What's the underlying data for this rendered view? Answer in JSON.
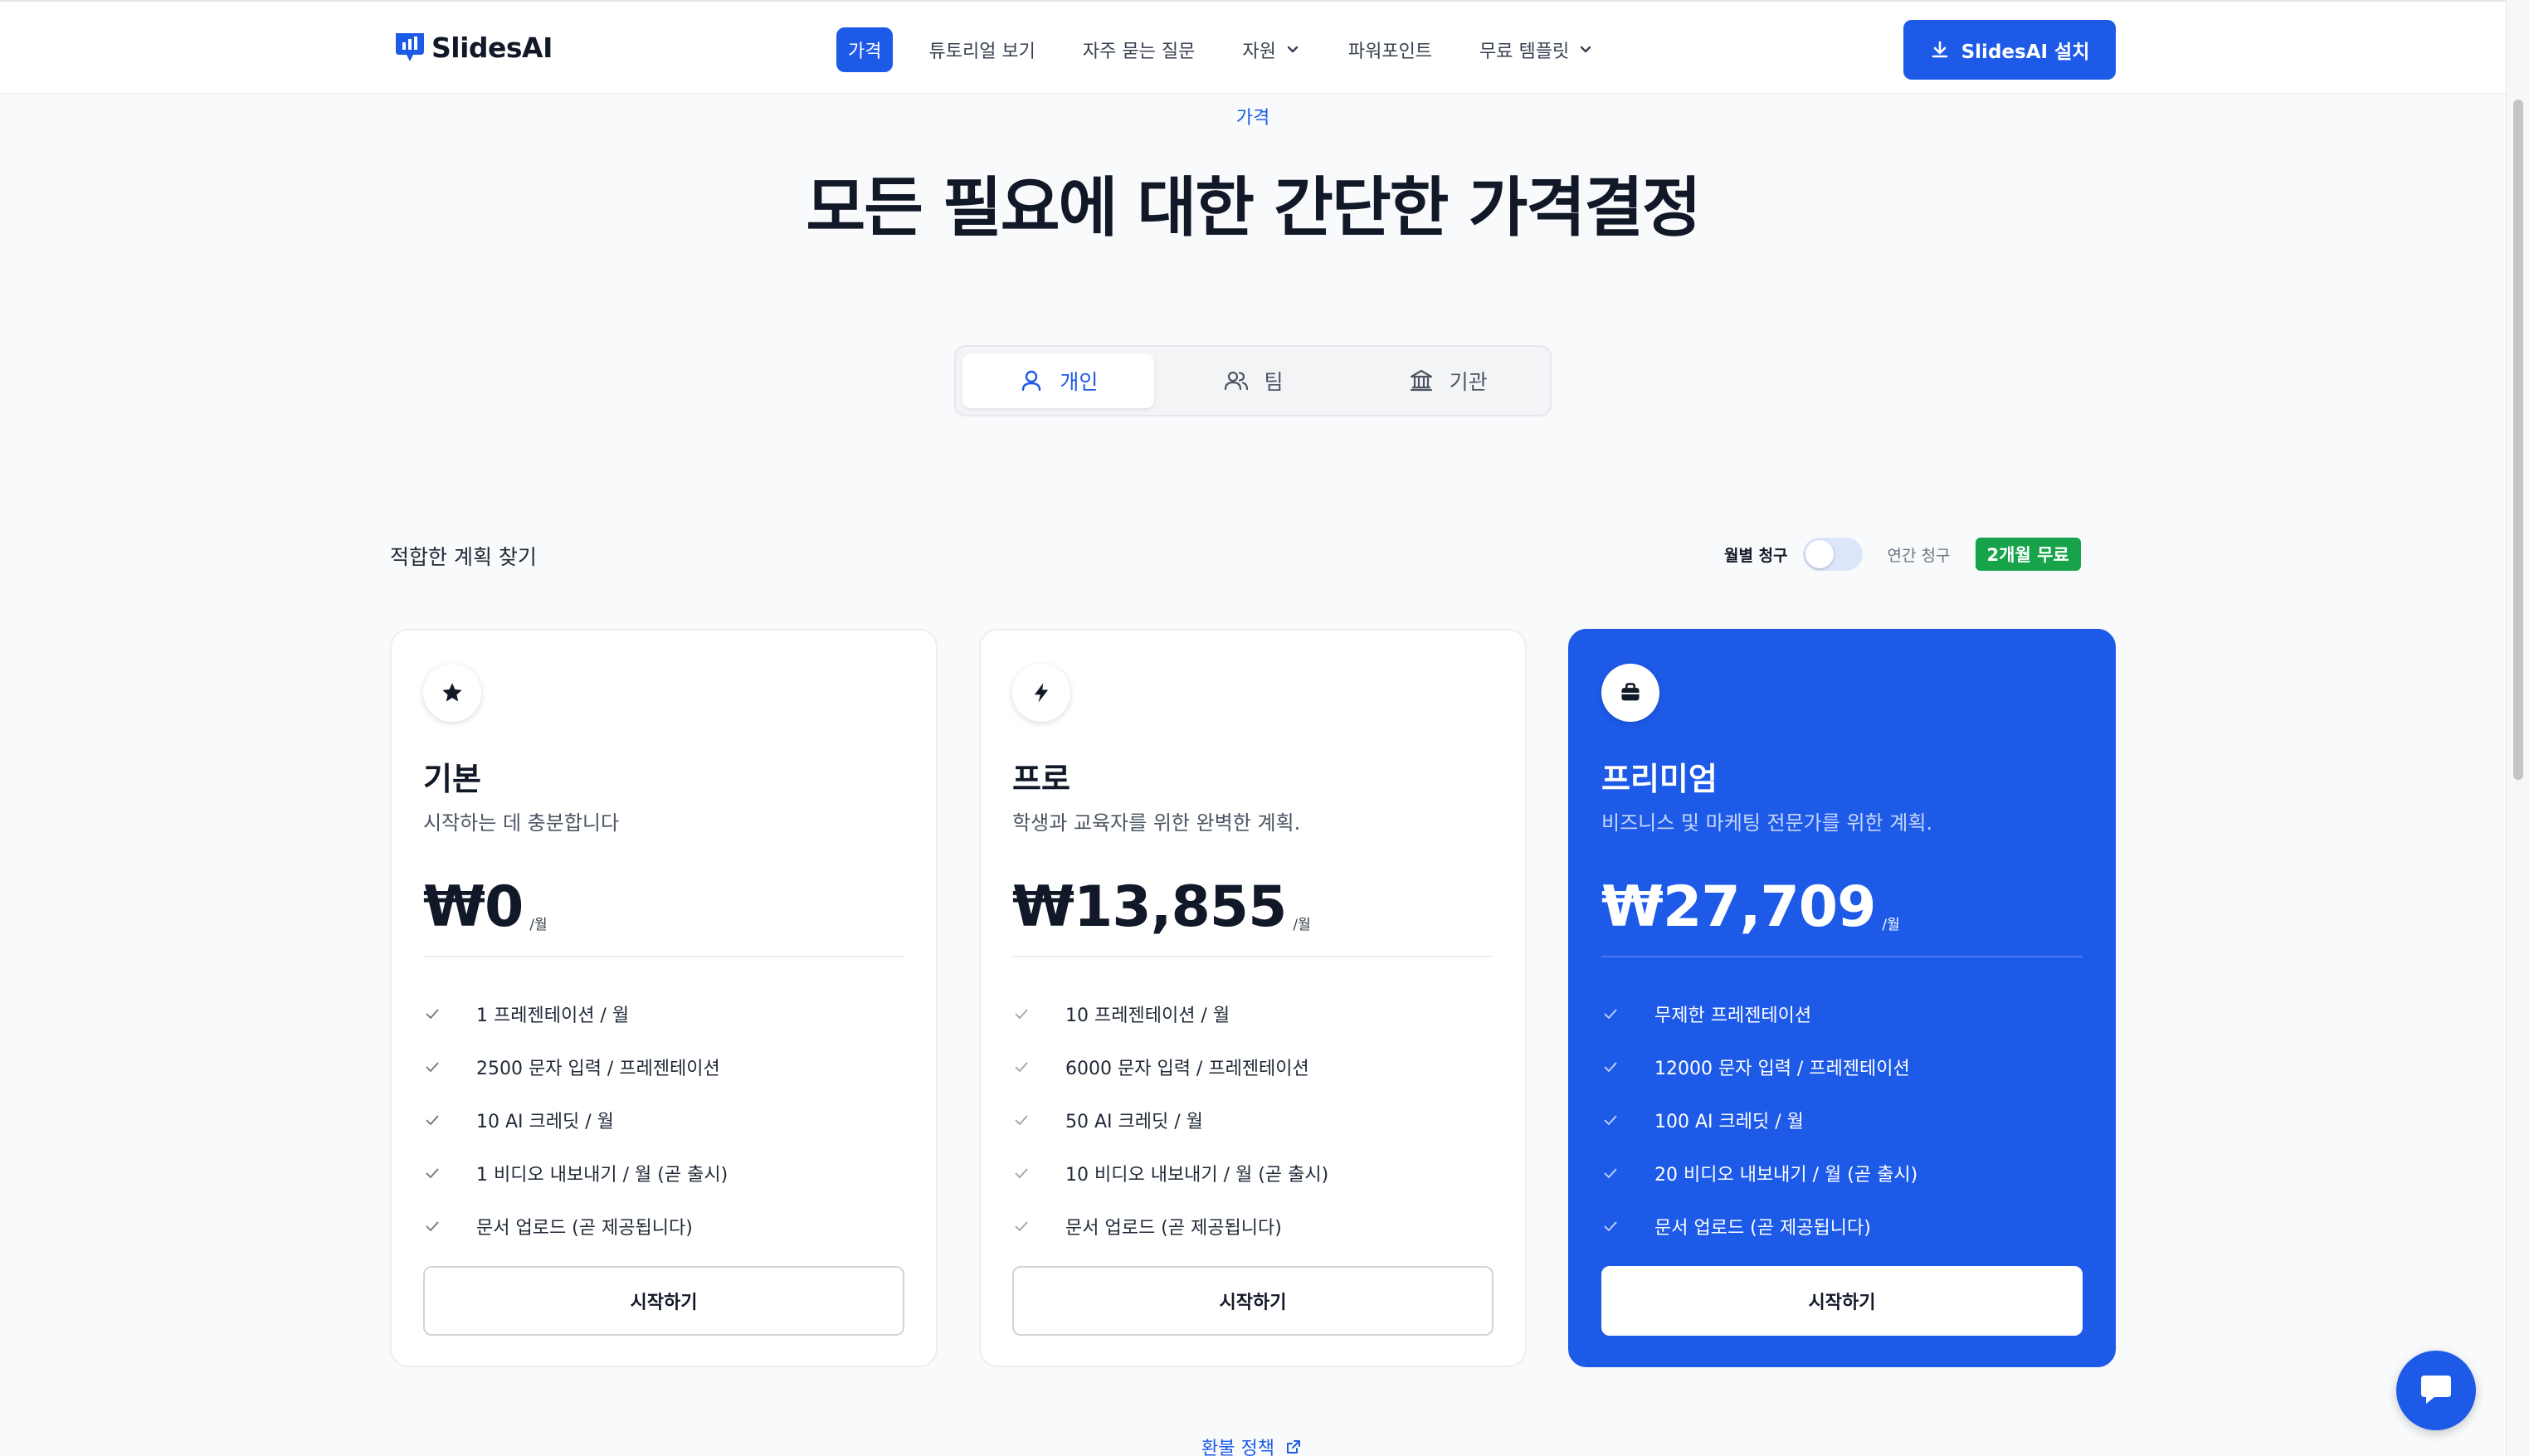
{
  "brand": {
    "name": "SlidesAI"
  },
  "nav": {
    "items": [
      {
        "label": "가격",
        "active": true,
        "dropdown": false
      },
      {
        "label": "튜토리얼 보기",
        "active": false,
        "dropdown": false
      },
      {
        "label": "자주 묻는 질문",
        "active": false,
        "dropdown": false
      },
      {
        "label": "자원",
        "active": false,
        "dropdown": true
      },
      {
        "label": "파워포인트",
        "active": false,
        "dropdown": false
      },
      {
        "label": "무료 템플릿",
        "active": false,
        "dropdown": true
      }
    ],
    "install_label": "SlidesAI 설치"
  },
  "hero": {
    "eyebrow": "가격",
    "title": "모든 필요에 대한 간단한 가격결정"
  },
  "segment": {
    "tabs": [
      {
        "label": "개인",
        "icon": "user-icon",
        "active": true
      },
      {
        "label": "팀",
        "icon": "users-icon",
        "active": false
      },
      {
        "label": "기관",
        "icon": "institution-icon",
        "active": false
      }
    ]
  },
  "plans_header": {
    "find_label": "적합한 계획 찾기",
    "monthly_label": "월별 청구",
    "yearly_label": "연간 청구",
    "discount_badge": "2개월 무료",
    "annual_selected": false
  },
  "plans": [
    {
      "name": "기본",
      "description": "시작하는 데 충분합니다",
      "price": "₩0",
      "per": "/월",
      "icon": "star-icon",
      "features": [
        "1 프레젠테이션 / 월",
        "2500 문자 입력 / 프레젠테이션",
        "10 AI 크레딧 / 월",
        "1 비디오 내보내기 / 월 (곧 출시)",
        "문서 업로드 (곧 제공됩니다)"
      ],
      "cta": "시작하기",
      "highlighted": false
    },
    {
      "name": "프로",
      "description": "학생과 교육자를 위한 완벽한 계획.",
      "price": "₩13,855",
      "per": "/월",
      "icon": "lightning-icon",
      "features": [
        "10 프레젠테이션 / 월",
        "6000 문자 입력 / 프레젠테이션",
        "50 AI 크레딧 / 월",
        "10 비디오 내보내기 / 월 (곧 출시)",
        "문서 업로드 (곧 제공됩니다)"
      ],
      "cta": "시작하기",
      "highlighted": false
    },
    {
      "name": "프리미엄",
      "description": "비즈니스 및 마케팅 전문가를 위한 계획.",
      "price": "₩27,709",
      "per": "/월",
      "icon": "briefcase-icon",
      "features": [
        "무제한 프레젠테이션",
        "12000 문자 입력 / 프레젠테이션",
        "100 AI 크레딧 / 월",
        "20 비디오 내보내기 / 월 (곧 출시)",
        "문서 업로드 (곧 제공됩니다)"
      ],
      "cta": "시작하기",
      "highlighted": true
    }
  ],
  "footer_link": {
    "label": "환불 정책"
  },
  "colors": {
    "accent": "#1d5ae8",
    "badge": "#16a34a"
  }
}
